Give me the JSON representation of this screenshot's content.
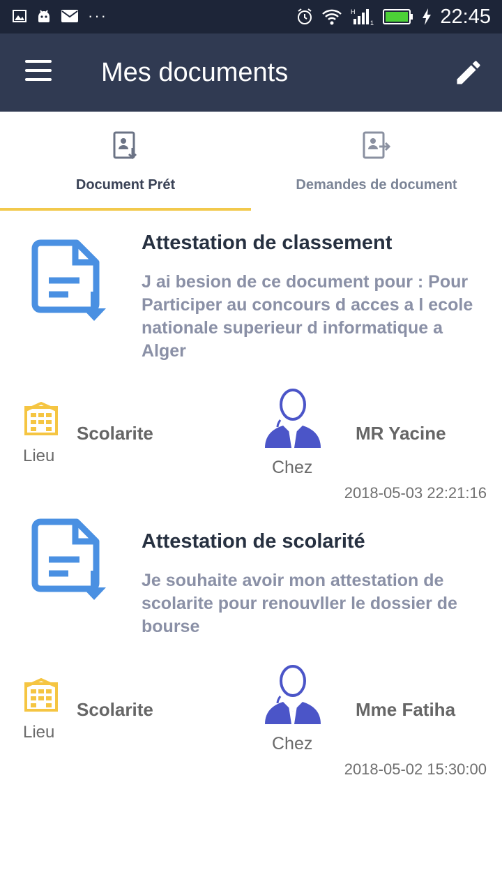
{
  "status_bar": {
    "time": "22:45",
    "left_icons": [
      "image-icon",
      "android-icon",
      "mail-icon",
      "more-dots-icon"
    ],
    "right_icons": [
      "alarm-icon",
      "wifi-icon",
      "signal-icon",
      "battery-icon",
      "charging-icon"
    ]
  },
  "app_bar": {
    "title": "Mes documents",
    "menu_icon": "menu-icon",
    "edit_icon": "edit-icon"
  },
  "tabs": [
    {
      "label": "Document Prét",
      "icon": "document-download-icon",
      "active": true
    },
    {
      "label": "Demandes de document",
      "icon": "document-send-icon",
      "active": false
    }
  ],
  "colors": {
    "status_bar": "#1d2538",
    "app_bar": "#303a52",
    "tab_indicator": "#f2c94c",
    "doc_icon": "#4a90e2",
    "lieu_icon": "#f5c542",
    "person_icon": "#4b55c8"
  },
  "documents": [
    {
      "title": "Attestation de classement",
      "description": "J ai besion de ce document pour : Pour Participer au concours d acces a l ecole nationale superieur d informatique a Alger",
      "lieu_label": "Lieu",
      "lieu_value": "Scolarite",
      "chez_label": "Chez",
      "person": "MR Yacine",
      "timestamp": "2018-05-03 22:21:16"
    },
    {
      "title": "Attestation de scolarité",
      "description": "Je souhaite avoir mon attestation de scolarite pour renouvller le dossier de bourse",
      "lieu_label": "Lieu",
      "lieu_value": "Scolarite",
      "chez_label": "Chez",
      "person": "Mme Fatiha",
      "timestamp": "2018-05-02 15:30:00"
    }
  ]
}
